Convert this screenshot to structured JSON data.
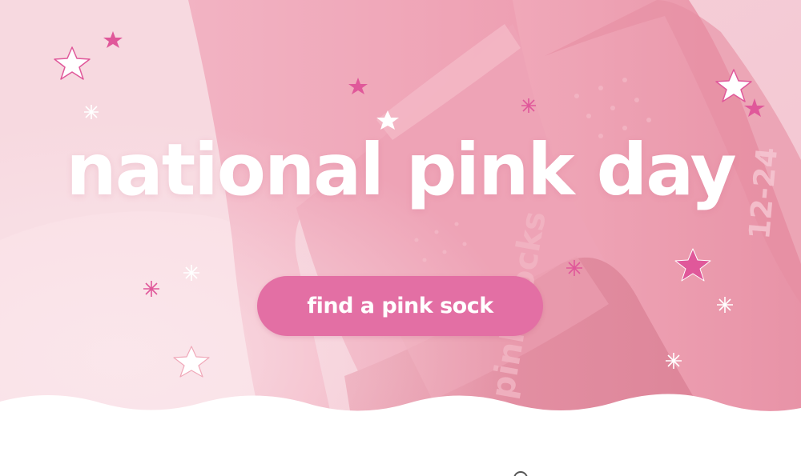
{
  "hero": {
    "title": "national pink day",
    "cta_label": "find a pink sock",
    "background": "pink-socks-photo",
    "sock_print_upper": "12-24",
    "sock_print_lower": "pink socks"
  },
  "colors": {
    "accent": "#e36fa4",
    "star_pink": "#e0589a",
    "text": "#ffffff",
    "background": "#f1b6c4"
  },
  "decorations": {
    "icons": [
      "star-icon",
      "sparkle-icon",
      "wave-divider"
    ]
  }
}
